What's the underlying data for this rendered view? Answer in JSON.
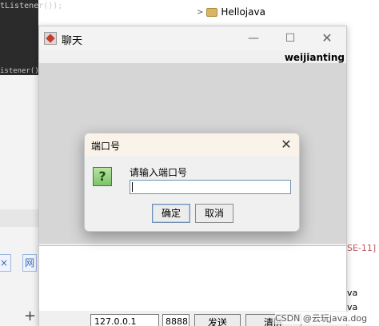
{
  "background": {
    "code_line_top": "tListener());",
    "code_line_bottom": "istener(){",
    "tree_item": "Hellojava",
    "tab_label_1": "×",
    "tab_label_2": "网",
    "plus_label": "+",
    "se_label": "SE-11]",
    "java_label_1": "va",
    "java_label_2": "va",
    "watermark": "CSDN @云玩java.dog"
  },
  "chat_window": {
    "title": "聊天",
    "minimize_label": "—",
    "maximize_label": "☐",
    "close_label": "✕",
    "username": "weijianting",
    "ip_value": "127.0.0.1",
    "port_value": "8888",
    "send_label": "发送",
    "clear_label": "清屏"
  },
  "dialog": {
    "title": "端口号",
    "close_label": "✕",
    "icon_glyph": "?",
    "message": "请输入端口号",
    "input_value": "",
    "ok_label": "确定",
    "cancel_label": "取消"
  }
}
